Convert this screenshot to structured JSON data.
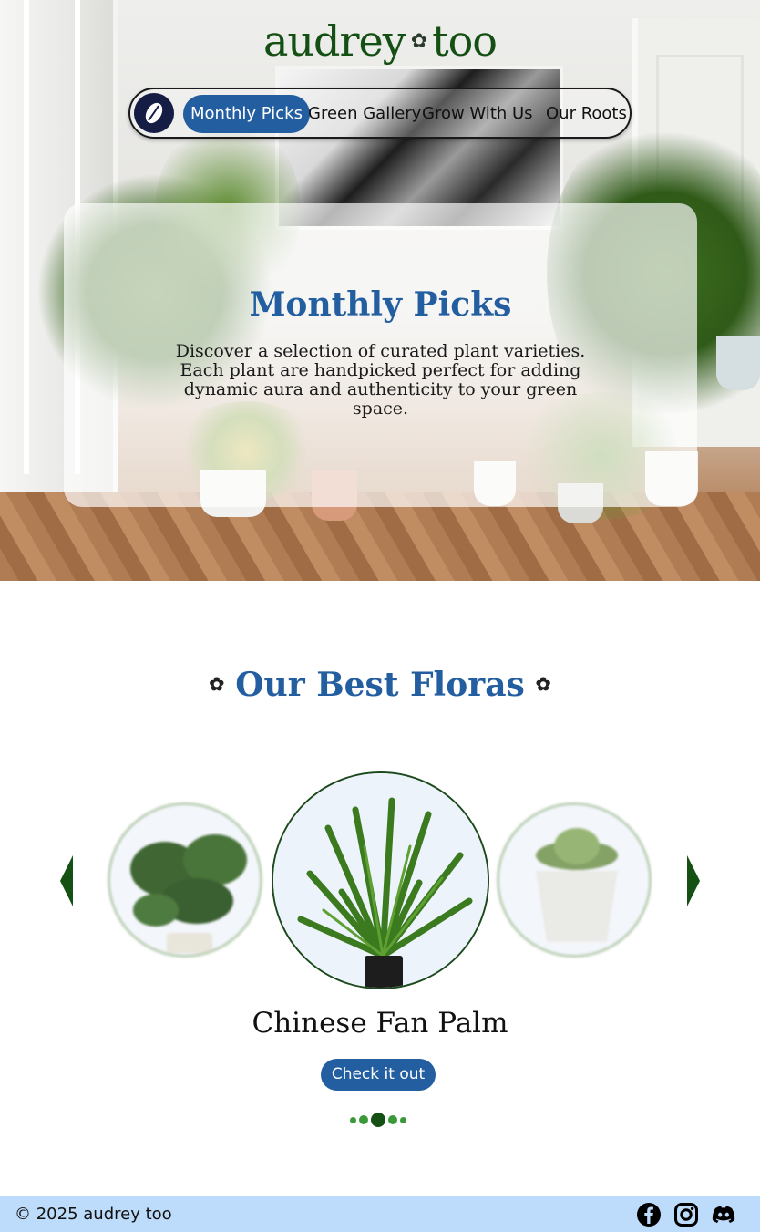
{
  "brand": {
    "name_left": "audrey",
    "name_right": "too",
    "flower_glyph": "✿"
  },
  "nav": {
    "logo_icon": "leaf-icon",
    "items": [
      {
        "label": "Monthly Picks",
        "active": true
      },
      {
        "label": "Green Gallery",
        "active": false
      },
      {
        "label": "Grow With Us",
        "active": false
      },
      {
        "label": "Our Roots",
        "active": false
      }
    ]
  },
  "hero": {
    "title": "Monthly Picks",
    "text": "Discover a selection of curated plant varieties. Each plant are handpicked  perfect for adding dynamic aura and authenticity to your green space."
  },
  "floras": {
    "title": "Our Best Floras",
    "flower_glyph": "✿",
    "current_plant": "Chinese Fan Palm",
    "cta_label": "Check it out",
    "slides": [
      {
        "name": "monstera-plant-image",
        "position": "previous"
      },
      {
        "name": "fan-palm-plant-image",
        "position": "current"
      },
      {
        "name": "succulent-plant-image",
        "position": "next"
      }
    ],
    "dots_total": 5,
    "active_dot": 3
  },
  "footer": {
    "copyright": "© 2025 audrey too",
    "social": [
      "facebook-icon",
      "instagram-icon",
      "discord-icon"
    ]
  },
  "colors": {
    "primary_blue": "#235ea0",
    "brand_green": "#144f14",
    "footer_bg": "#bddbfb",
    "nav_logo_bg": "#151d45"
  }
}
